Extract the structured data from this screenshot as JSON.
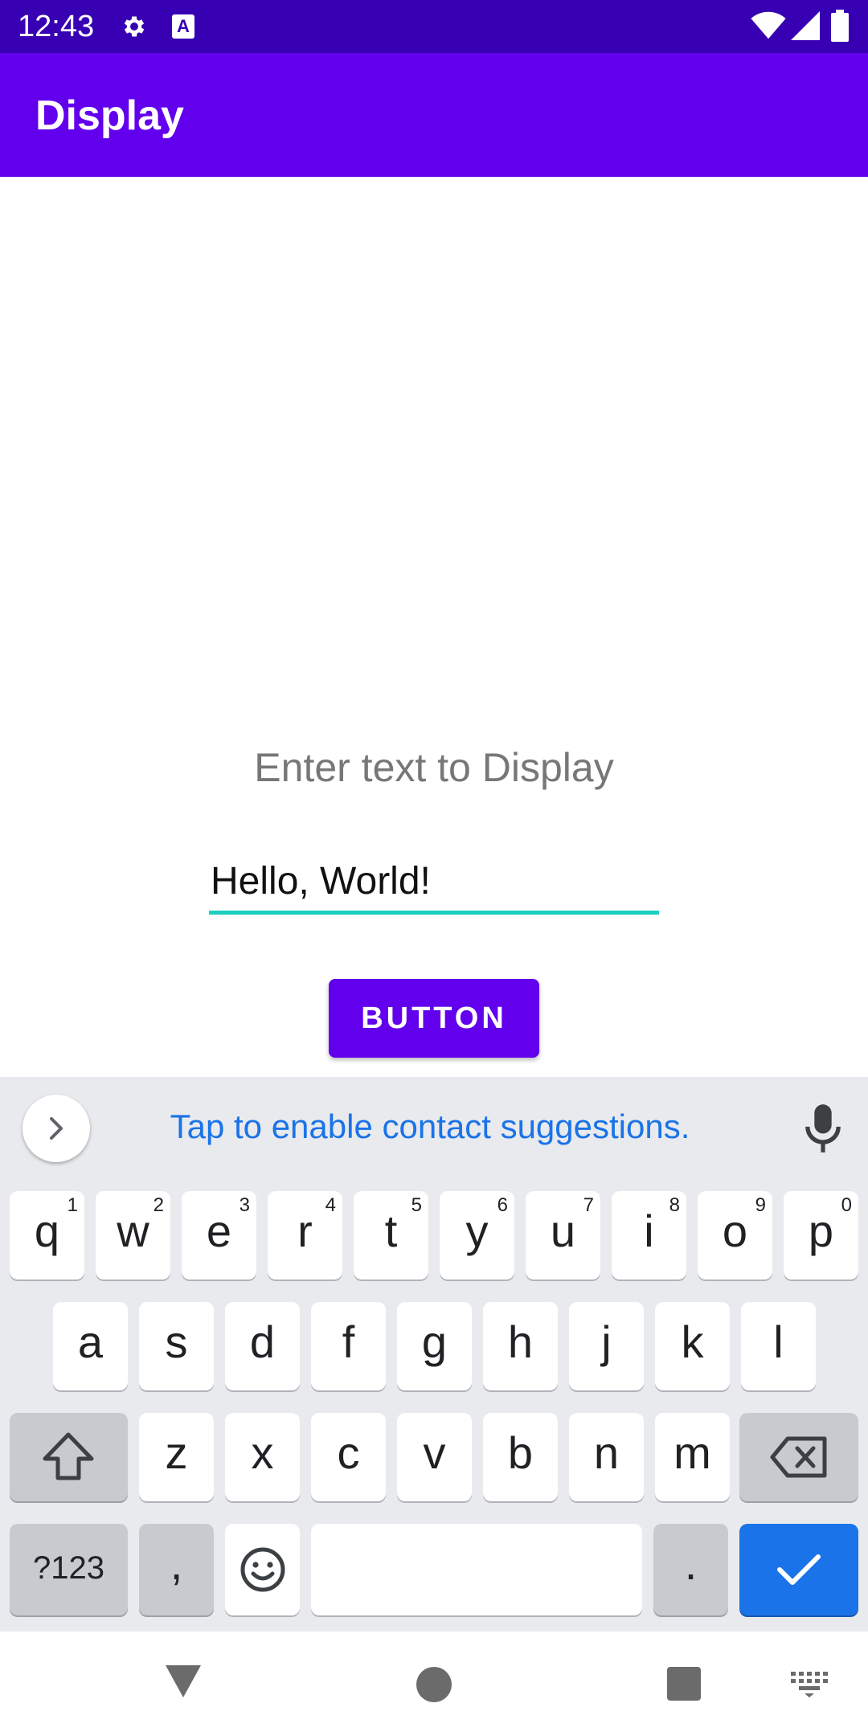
{
  "status_bar": {
    "time": "12:43",
    "icons": [
      "gear-icon",
      "text-a-icon",
      "wifi-icon",
      "signal-icon",
      "battery-icon"
    ],
    "a_badge": "A"
  },
  "app_bar": {
    "title": "Display",
    "color": "#6200ee",
    "status_color": "#3700b3"
  },
  "content": {
    "prompt": "Enter text to Display",
    "input_value": "Hello, World!",
    "button_label": "BUTTON",
    "field_underline_color": "#1dcfc0"
  },
  "keyboard": {
    "suggestion": "Tap to enable contact suggestions.",
    "row1": [
      {
        "key": "q",
        "num": "1"
      },
      {
        "key": "w",
        "num": "2"
      },
      {
        "key": "e",
        "num": "3"
      },
      {
        "key": "r",
        "num": "4"
      },
      {
        "key": "t",
        "num": "5"
      },
      {
        "key": "y",
        "num": "6"
      },
      {
        "key": "u",
        "num": "7"
      },
      {
        "key": "i",
        "num": "8"
      },
      {
        "key": "o",
        "num": "9"
      },
      {
        "key": "p",
        "num": "0"
      }
    ],
    "row2": [
      "a",
      "s",
      "d",
      "f",
      "g",
      "h",
      "j",
      "k",
      "l"
    ],
    "row3": [
      "z",
      "x",
      "c",
      "v",
      "b",
      "n",
      "m"
    ],
    "symbols_label": "?123",
    "comma_label": ",",
    "period_label": ".",
    "accent_color": "#1a73e8"
  },
  "nav_bar": {
    "icons": [
      "back-icon",
      "home-icon",
      "recents-icon",
      "keyboard-switch-icon"
    ]
  }
}
